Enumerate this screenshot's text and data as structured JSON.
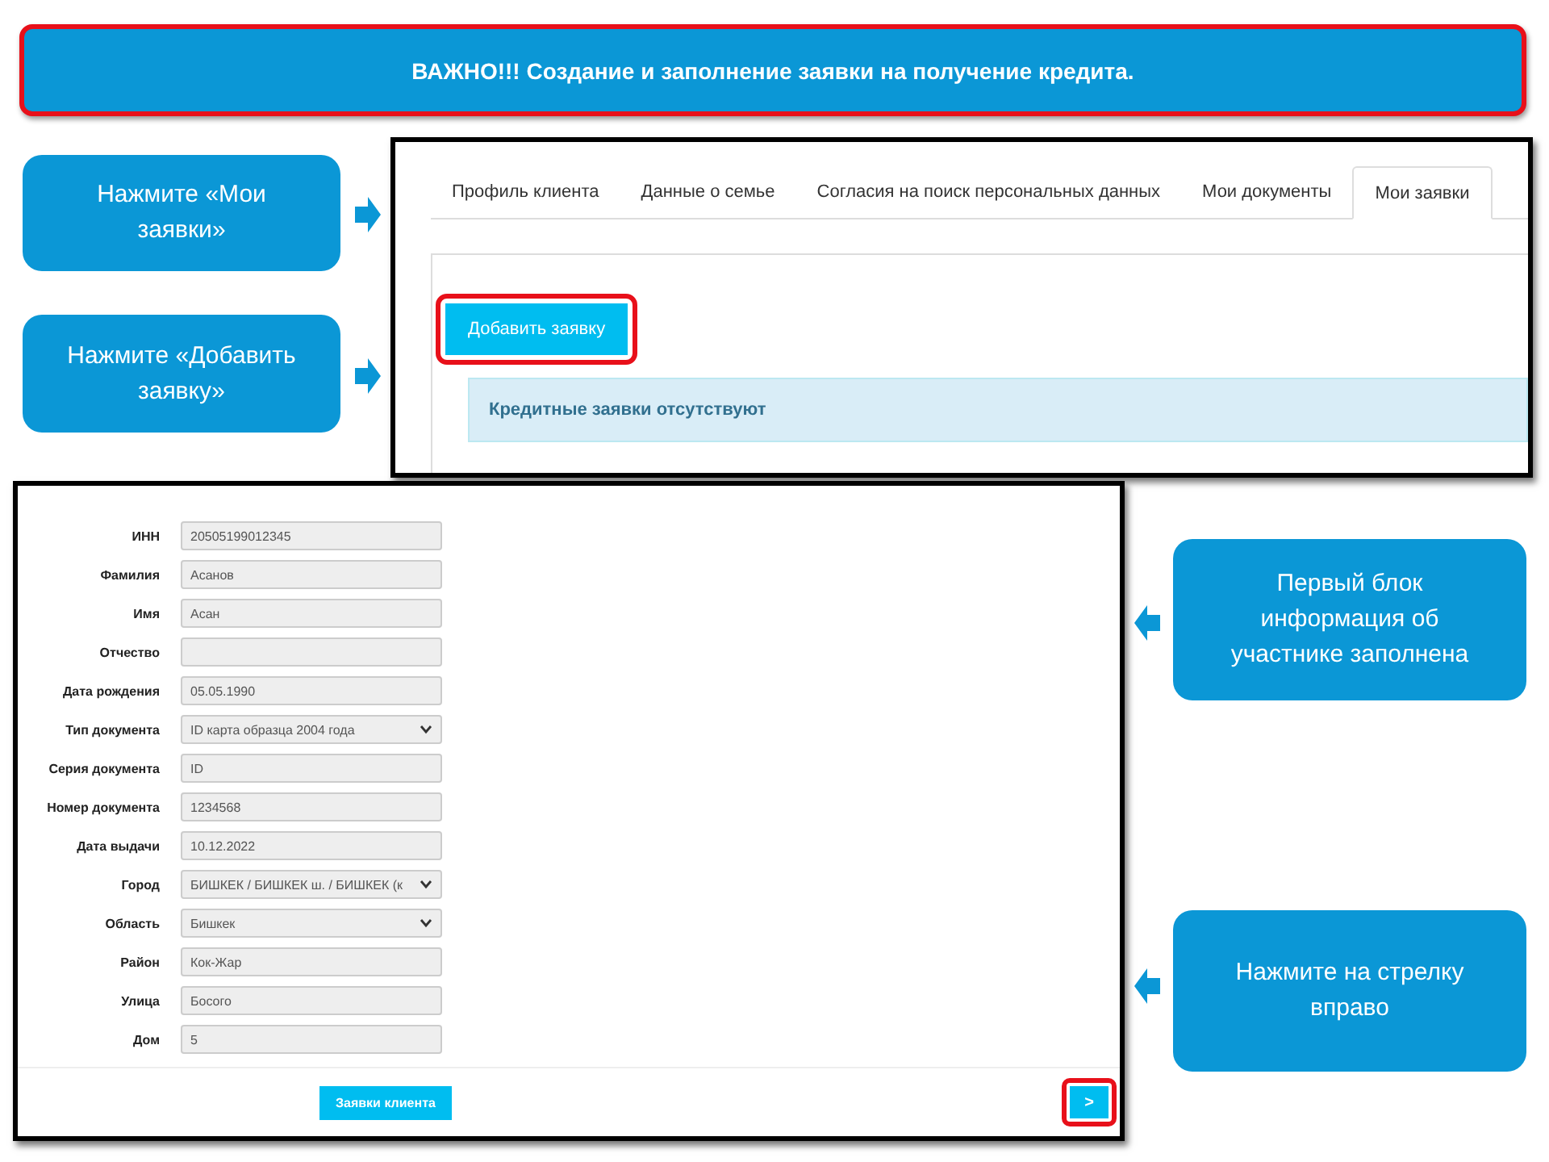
{
  "banner": {
    "text": "ВАЖНО!!! Создание и заполнение заявки на получение кредита."
  },
  "callouts": [
    {
      "text": "Нажмите «Мои заявки»",
      "kind": "left"
    },
    {
      "text": "Нажмите «Добавить заявку»",
      "kind": "left"
    },
    {
      "text": "Первый блок информация об участнике заполнена",
      "kind": "right"
    },
    {
      "text": "Нажмите на стрелку вправо",
      "kind": "right"
    }
  ],
  "profile_screen": {
    "tabs": [
      {
        "label": "Профиль клиента",
        "selected": false
      },
      {
        "label": "Данные о семье",
        "selected": false
      },
      {
        "label": "Согласия на поиск персональных данных",
        "selected": false
      },
      {
        "label": "Мои документы",
        "selected": false
      },
      {
        "label": "Мои заявки",
        "selected": true
      }
    ],
    "add_button": {
      "label": "Добавить заявку",
      "highlighted": true
    },
    "notice": "Кредитные заявки отсутствуют"
  },
  "form_screen": {
    "fields": [
      {
        "label": "ИНН",
        "value": "20505199012345",
        "kind": "text"
      },
      {
        "label": "Фамилия",
        "value": "Асанов",
        "kind": "text"
      },
      {
        "label": "Имя",
        "value": "Асан",
        "kind": "text"
      },
      {
        "label": "Отчество",
        "kind": "text"
      },
      {
        "label": "Дата рождения",
        "value": "05.05.1990",
        "kind": "text"
      },
      {
        "label": "Тип документа",
        "value": "ID карта образца 2004 года",
        "kind": "select"
      },
      {
        "label": "Серия документа",
        "value": "ID",
        "kind": "text"
      },
      {
        "label": "Номер документа",
        "value": "1234568",
        "kind": "text"
      },
      {
        "label": "Дата выдачи",
        "value": "10.12.2022",
        "kind": "text"
      },
      {
        "label": "Город",
        "value": "БИШКЕК / БИШКЕК ш. / БИШКЕК (к",
        "kind": "select"
      },
      {
        "label": "Область",
        "value": "Бишкек",
        "kind": "select"
      },
      {
        "label": "Район",
        "value": "Кок-Жар",
        "kind": "text"
      },
      {
        "label": "Улица",
        "value": "Босого",
        "kind": "text"
      },
      {
        "label": "Дом",
        "value": "5",
        "kind": "text"
      }
    ],
    "client_button": "Заявки клиента",
    "next_button": {
      "label": ">",
      "highlighted": true
    }
  }
}
